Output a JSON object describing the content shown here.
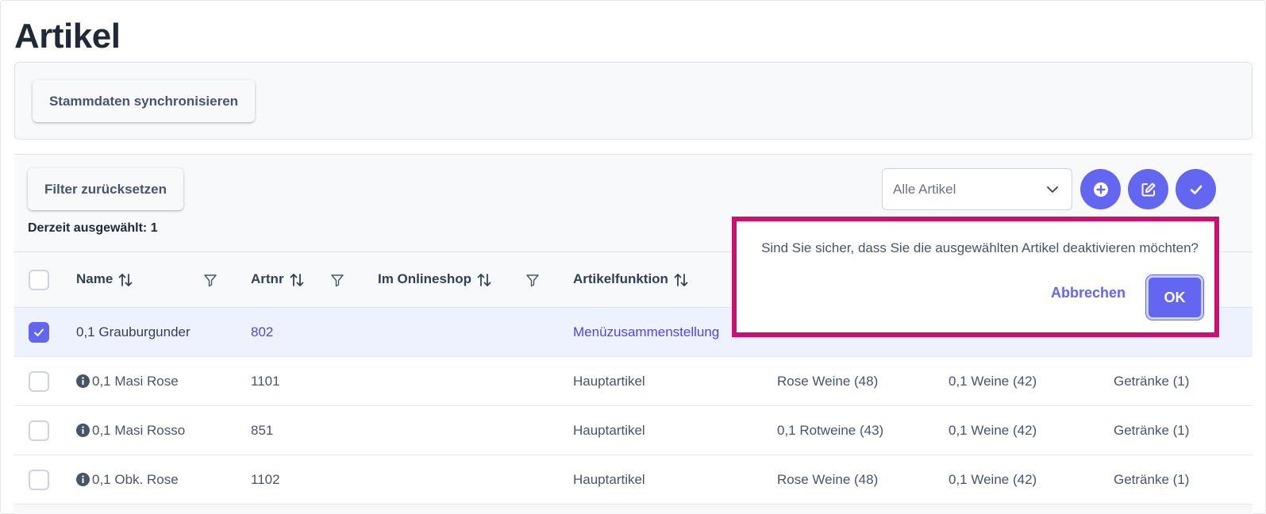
{
  "page": {
    "title": "Artikel"
  },
  "toolbar": {
    "sync_label": "Stammdaten synchronisieren"
  },
  "table_toolbar": {
    "reset_label": "Filter zurücksetzen",
    "selected_label": "Derzeit ausgewählt: 1",
    "filter_select": {
      "value": "Alle Artikel"
    }
  },
  "columns": {
    "name": "Name",
    "artnr": "Artnr",
    "onlineshop": "Im Onlineshop",
    "funktion": "Artikelfunktion"
  },
  "rows": [
    {
      "selected": true,
      "info": false,
      "name": "0,1 Grauburgunder",
      "artnr": "802",
      "onlineshop": "",
      "funktion": "Menüzusammenstellung",
      "group1": "",
      "group2": "",
      "group3": ""
    },
    {
      "selected": false,
      "info": true,
      "name": "0,1 Masi Rose",
      "artnr": "1101",
      "onlineshop": "",
      "funktion": "Hauptartikel",
      "group1": "Rose Weine (48)",
      "group2": "0,1 Weine (42)",
      "group3": "Getränke (1)"
    },
    {
      "selected": false,
      "info": true,
      "name": "0,1 Masi Rosso",
      "artnr": "851",
      "onlineshop": "",
      "funktion": "Hauptartikel",
      "group1": "0,1 Rotweine (43)",
      "group2": "0,1 Weine (42)",
      "group3": "Getränke (1)"
    },
    {
      "selected": false,
      "info": true,
      "name": "0,1 Obk. Rose",
      "artnr": "1102",
      "onlineshop": "",
      "funktion": "Hauptartikel",
      "group1": "Rose Weine (48)",
      "group2": "0,1 Weine (42)",
      "group3": "Getränke (1)"
    }
  ],
  "confirm_dialog": {
    "message": "Sind Sie sicher, dass Sie die ausgewählten Artikel deaktivieren möchten?",
    "cancel_label": "Abbrechen",
    "ok_label": "OK"
  },
  "icons": {
    "add": "plus-circle-icon",
    "edit": "edit-icon",
    "confirm": "check-icon",
    "sort": "sort-icon",
    "filter": "filter-icon",
    "info": "info-circle-icon",
    "chevron": "chevron-down-icon"
  },
  "colors": {
    "primary": "#6366f1",
    "highlight_border": "#cc0f72",
    "selected_row": "#eef2ff"
  }
}
